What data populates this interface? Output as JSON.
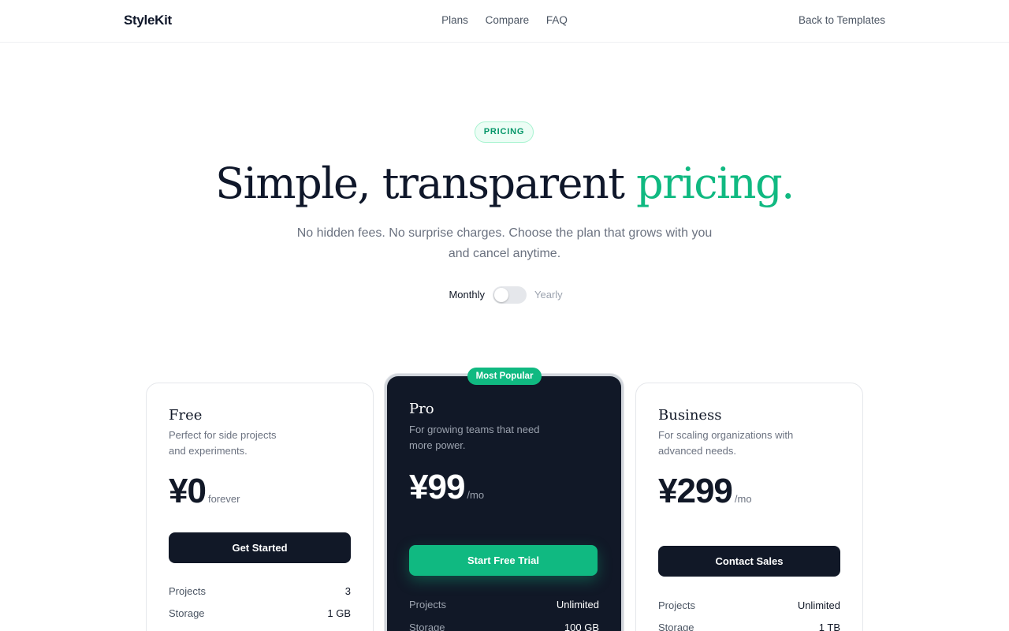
{
  "brand": "StyleKit",
  "nav": {
    "links": [
      "Plans",
      "Compare",
      "FAQ"
    ],
    "back": "Back to Templates"
  },
  "hero": {
    "badge": "PRICING",
    "title_main": "Simple, transparent ",
    "title_accent": "pricing.",
    "subtitle": "No hidden fees. No surprise charges. Choose the plan that grows with you and cancel anytime."
  },
  "billing": {
    "monthly": "Monthly",
    "yearly": "Yearly",
    "yearly_selected": false
  },
  "colors": {
    "accent": "#10b981",
    "dark": "#111827"
  },
  "plans": [
    {
      "name": "Free",
      "description": "Perfect for side projects and experiments.",
      "price": "¥0",
      "suffix": "forever",
      "cta": "Get Started",
      "features": [
        {
          "label": "Projects",
          "value": "3"
        },
        {
          "label": "Storage",
          "value": "1 GB"
        }
      ]
    },
    {
      "name": "Pro",
      "badge": "Most Popular",
      "description": "For growing teams that need more power.",
      "price": "¥99",
      "suffix": "/mo",
      "cta": "Start Free Trial",
      "features": [
        {
          "label": "Projects",
          "value": "Unlimited"
        },
        {
          "label": "Storage",
          "value": "100 GB"
        }
      ]
    },
    {
      "name": "Business",
      "description": "For scaling organizations with advanced needs.",
      "price": "¥299",
      "suffix": "/mo",
      "cta": "Contact Sales",
      "features": [
        {
          "label": "Projects",
          "value": "Unlimited"
        },
        {
          "label": "Storage",
          "value": "1 TB"
        }
      ]
    }
  ]
}
